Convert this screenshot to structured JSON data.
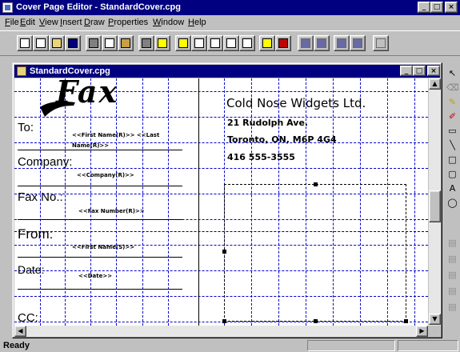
{
  "window": {
    "title": "Cover Page Editor - StandardCover.cpg"
  },
  "menu": [
    "File",
    "Edit",
    "View",
    "Insert",
    "Draw",
    "Properties",
    "Window",
    "Help"
  ],
  "menu_underline": [
    "F",
    "E",
    "V",
    "I",
    "D",
    "P",
    "W",
    "H"
  ],
  "toolbar_buttons": [
    "new-page-icon",
    "new-doc-icon",
    "open-icon",
    "save-icon",
    "cut-icon",
    "copy-icon",
    "paste-icon",
    "print-icon",
    "help-icon",
    "grid-icon",
    "page-view-icon",
    "preview-icon",
    "list-icon",
    "zoom-icon",
    "snap-icon",
    "record-icon",
    "first-icon",
    "prev-icon",
    "next-icon",
    "last-icon",
    "page-icon"
  ],
  "document": {
    "title": "StandardCover.cpg",
    "fax_logo": "Fax",
    "labels": {
      "to": "To:",
      "company": "Company:",
      "fax_no": "Fax No.:",
      "from": "From:",
      "date": "Date:",
      "cc": "CC:"
    },
    "fields": {
      "to_line1": "<<First Name(R)>>  <<Last",
      "to_line2": "Name(R)>>",
      "company": "<<Company(R)>>",
      "fax_number": "<<Fax Number(R)>>",
      "from": "<<First Name(S)>>",
      "date": "<<Date>>"
    },
    "company_name": "Cold Nose Widgets Ltd.",
    "address": [
      "21 Rudolph Ave.",
      "Toronto, ON,  M6P 4G4",
      "416 555-3555"
    ]
  },
  "palette_tools": [
    "pointer-icon",
    "eraser-icon",
    "pencil-icon",
    "marker-icon",
    "text-box-icon",
    "line-icon",
    "rectangle-icon",
    "rounded-rect-icon",
    "text-icon",
    "ellipse-icon"
  ],
  "status": {
    "message": "Ready"
  }
}
